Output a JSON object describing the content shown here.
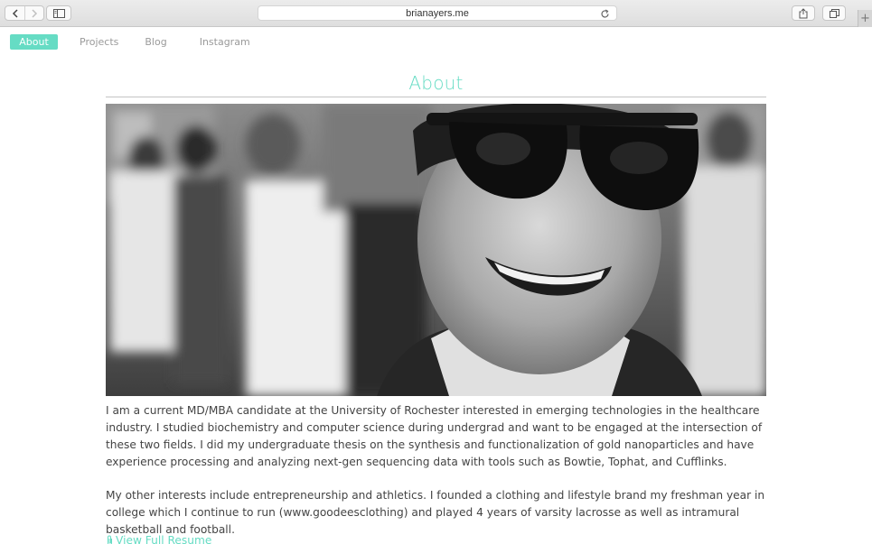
{
  "browser": {
    "url": "brianayers.me",
    "icons": {
      "back": "chevron-left-icon",
      "forward": "chevron-right-icon",
      "sidebar": "sidebar-icon",
      "reload": "reload-icon",
      "share": "share-icon",
      "tabs": "tabs-icon",
      "new_tab": "plus-icon"
    },
    "new_tab_label": "+"
  },
  "nav": {
    "items": [
      {
        "label": "About",
        "active": true
      },
      {
        "label": "Projects",
        "active": false
      },
      {
        "label": "Blog",
        "active": false
      },
      {
        "label": "Instagram",
        "active": false
      }
    ]
  },
  "page": {
    "title": "About",
    "paragraphs": [
      "I am a current MD/MBA candidate at the University of Rochester interested in emerging technologies in the healthcare industry. I studied biochemistry and computer science during undergrad and want to be engaged at the intersection of these two fields. I did my undergraduate thesis on the synthesis and functionalization of gold nanoparticles and have experience processing and analyzing next-gen sequencing data with tools such as Bowtie, Tophat, and Cufflinks.",
      "My other interests include entrepreneurship and athletics. I founded a clothing and lifestyle brand my freshman year in college which I continue to run (www.goodeesclothing) and played 4 years of varsity lacrosse as well as intramural basketball and football."
    ],
    "resume_link": "View Full Resume",
    "resume_icon": "paperclip-icon"
  },
  "colors": {
    "accent": "#66dcc4",
    "nav_text": "#9a9a9a",
    "body_text": "#444444",
    "rule": "#c4c4c4"
  }
}
